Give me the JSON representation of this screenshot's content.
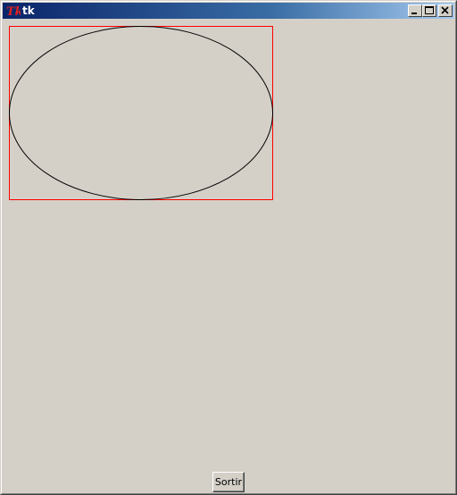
{
  "window": {
    "title": "tk",
    "icon": "tk-feather-icon",
    "controls": [
      "minimize-icon",
      "maximize-icon",
      "close-icon"
    ]
  },
  "canvas": {
    "shapes": [
      {
        "type": "rectangle",
        "outline": "#ff0000"
      },
      {
        "type": "oval",
        "outline": "#000000"
      }
    ]
  },
  "buttons": {
    "quit_label": "Sortir"
  },
  "colors": {
    "background": "#d4d0c8",
    "titlebar_start": "#0a246a",
    "titlebar_end": "#a6caf0"
  }
}
